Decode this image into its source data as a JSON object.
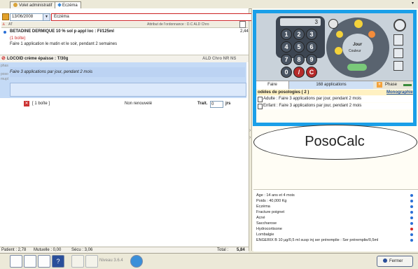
{
  "tabs": [
    {
      "label": "Volet administratif"
    },
    {
      "label": "Eczéma"
    }
  ],
  "header": {
    "date": "13/06/2008",
    "title": "Eczéma",
    "col_at": "AT",
    "col_attribut": "Attribut de l'ordonnance :  D.C  ALD  Chro"
  },
  "med1": {
    "name": "BETADINE DERMIQUE 10 % sol p appl loc : Fl/125ml",
    "qty": "(1 boîte)",
    "poso": "Faire 1 application le matin et le soir, pendant 2 semaines",
    "price": "2,44"
  },
  "med2": {
    "name": "LOCOID crème épaisse : T/30g",
    "flags": "ALD  Chro  NR  NS",
    "poso": "Faire 3 applications par jour, pendant 2 mois",
    "side1": "phas",
    "side2": "poso",
    "side3": "mupl",
    "qty": "[ 1 boîte ]",
    "renew": "Non renouvelé",
    "trait_label": "Trait.",
    "trait_value": "0",
    "trait_unit": "jrs"
  },
  "calc": {
    "display": "3",
    "keys": [
      "1",
      "2",
      "3",
      "4",
      "5",
      "6",
      "7",
      "8",
      "9",
      "0",
      "/",
      "C"
    ],
    "tab_faire": "Faire",
    "tab_count": "168 applications",
    "tab_phase": "Phase",
    "jour_label": "Jour",
    "couleur_label": "Couleur"
  },
  "models": {
    "header": "odèles de posologies ( 2 )",
    "link": "Monographie",
    "rows": [
      "Adulte : Faire 3 applications par jour, pendant 2 mois",
      "Enfant : Faire 3 applications par jour, pendant 2 mois"
    ]
  },
  "posocalc_label": "PosoCalc",
  "patient_info": [
    {
      "text": "Age : 14 ans et 4 mois",
      "status_color": "#2a6fd6"
    },
    {
      "text": "Poids : 40,000 Kg",
      "status_color": "#2a6fd6"
    },
    {
      "text": "Eczéma",
      "status_color": "#2a6fd6"
    },
    {
      "text": "Fracture poignet",
      "status_color": "#2a6fd6"
    },
    {
      "text": "Acné",
      "status_color": "#2a6fd6"
    },
    {
      "text": "Saccharose",
      "status_color": "#2a6fd6"
    },
    {
      "text": "Hydrocortisone",
      "status_color": "#d62a2a"
    },
    {
      "text": "Lombalgie",
      "status_color": "#2a6fd6"
    },
    {
      "text": "ENGERIX B 10 µg/0,5 ml susp inj ser préremplie : Ser préremplie/0,5ml",
      "status_color": "#2a6fd6"
    }
  ],
  "status": {
    "patient": "Patient : 2,78",
    "mutuelle": "Mutuelle : 0,00",
    "secu": "Sécu : 3,06",
    "total_label": "Total :",
    "total_value": "5,84"
  },
  "toolbar": {
    "niveau": "Niveau 3.6.4",
    "close": "Fermer"
  }
}
